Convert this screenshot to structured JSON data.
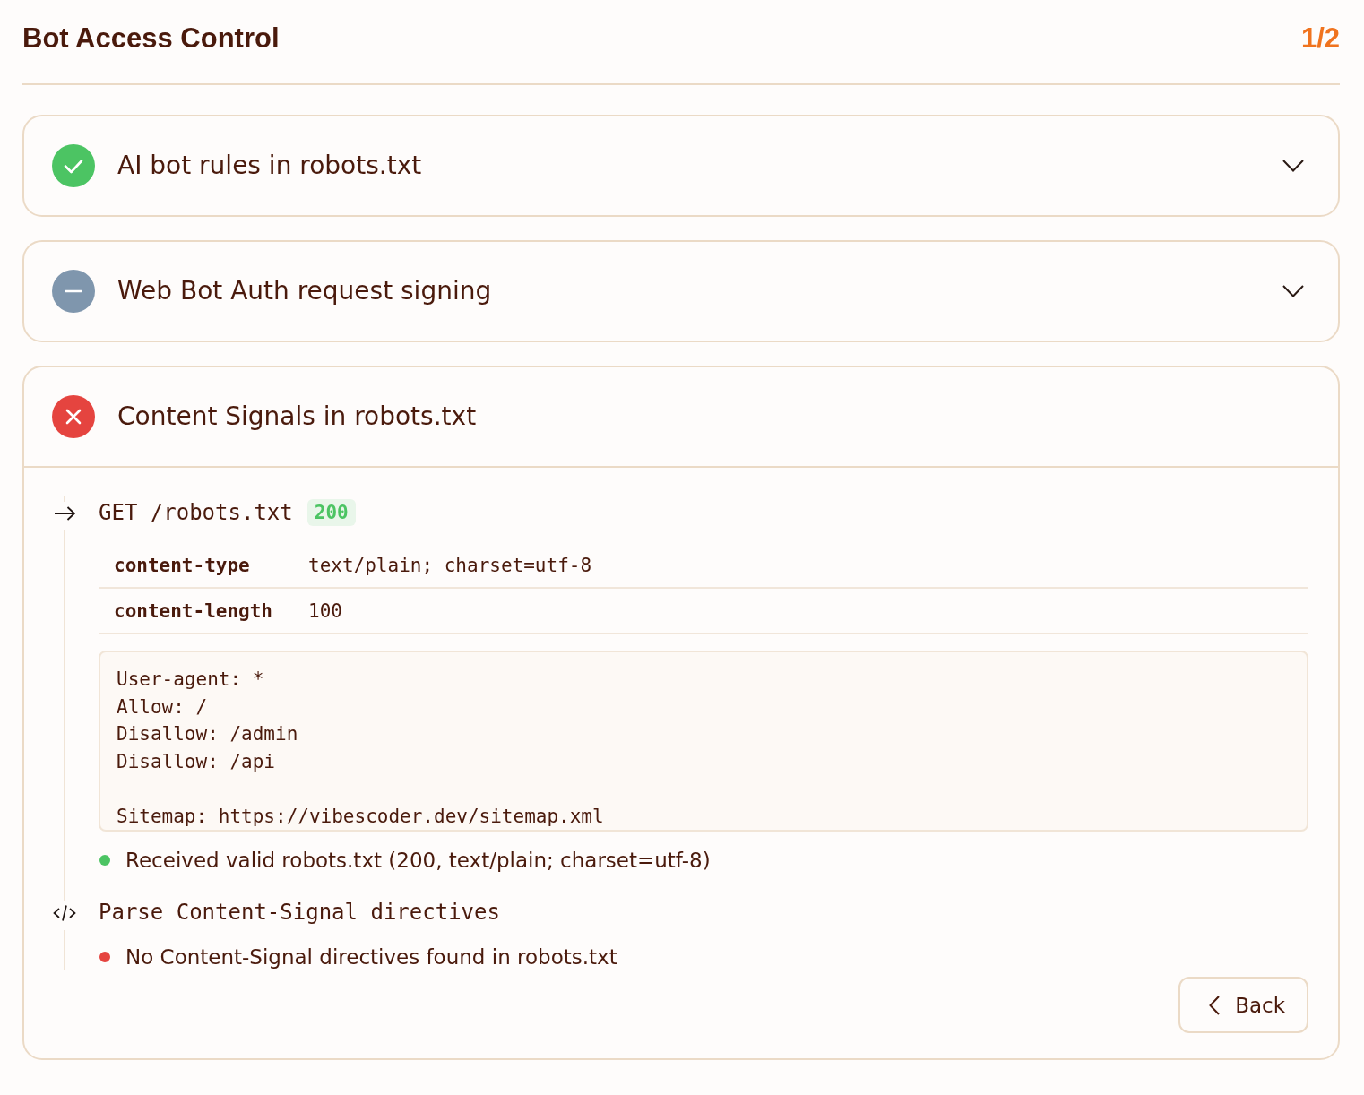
{
  "header": {
    "title": "Bot Access Control",
    "progress": "1/2"
  },
  "checks": [
    {
      "title": "AI bot rules in robots.txt",
      "kind": "pass",
      "expanded": false
    },
    {
      "title": "Web Bot Auth request signing",
      "kind": "neutral",
      "expanded": false
    },
    {
      "title": "Content Signals in robots.txt",
      "kind": "fail",
      "expanded": true,
      "steps": [
        {
          "kind": "request",
          "title": "GET /robots.txt",
          "status_code": "200",
          "headers": [
            {
              "name": "content-type",
              "value": "text/plain; charset=utf-8"
            },
            {
              "name": "content-length",
              "value": "100"
            }
          ],
          "body": "User-agent: *\nAllow: /\nDisallow: /admin\nDisallow: /api\n\nSitemap: https://vibescoder.dev/sitemap.xml",
          "messages": [
            {
              "text": "Received valid robots.txt (200, text/plain; charset=utf-8)",
              "color": "#4cc463"
            }
          ]
        },
        {
          "kind": "parse",
          "title": "Parse Content-Signal directives",
          "messages": [
            {
              "text": "No Content-Signal directives found in robots.txt",
              "color": "#e5443f"
            }
          ]
        }
      ]
    }
  ],
  "back_button": {
    "label": "Back"
  }
}
